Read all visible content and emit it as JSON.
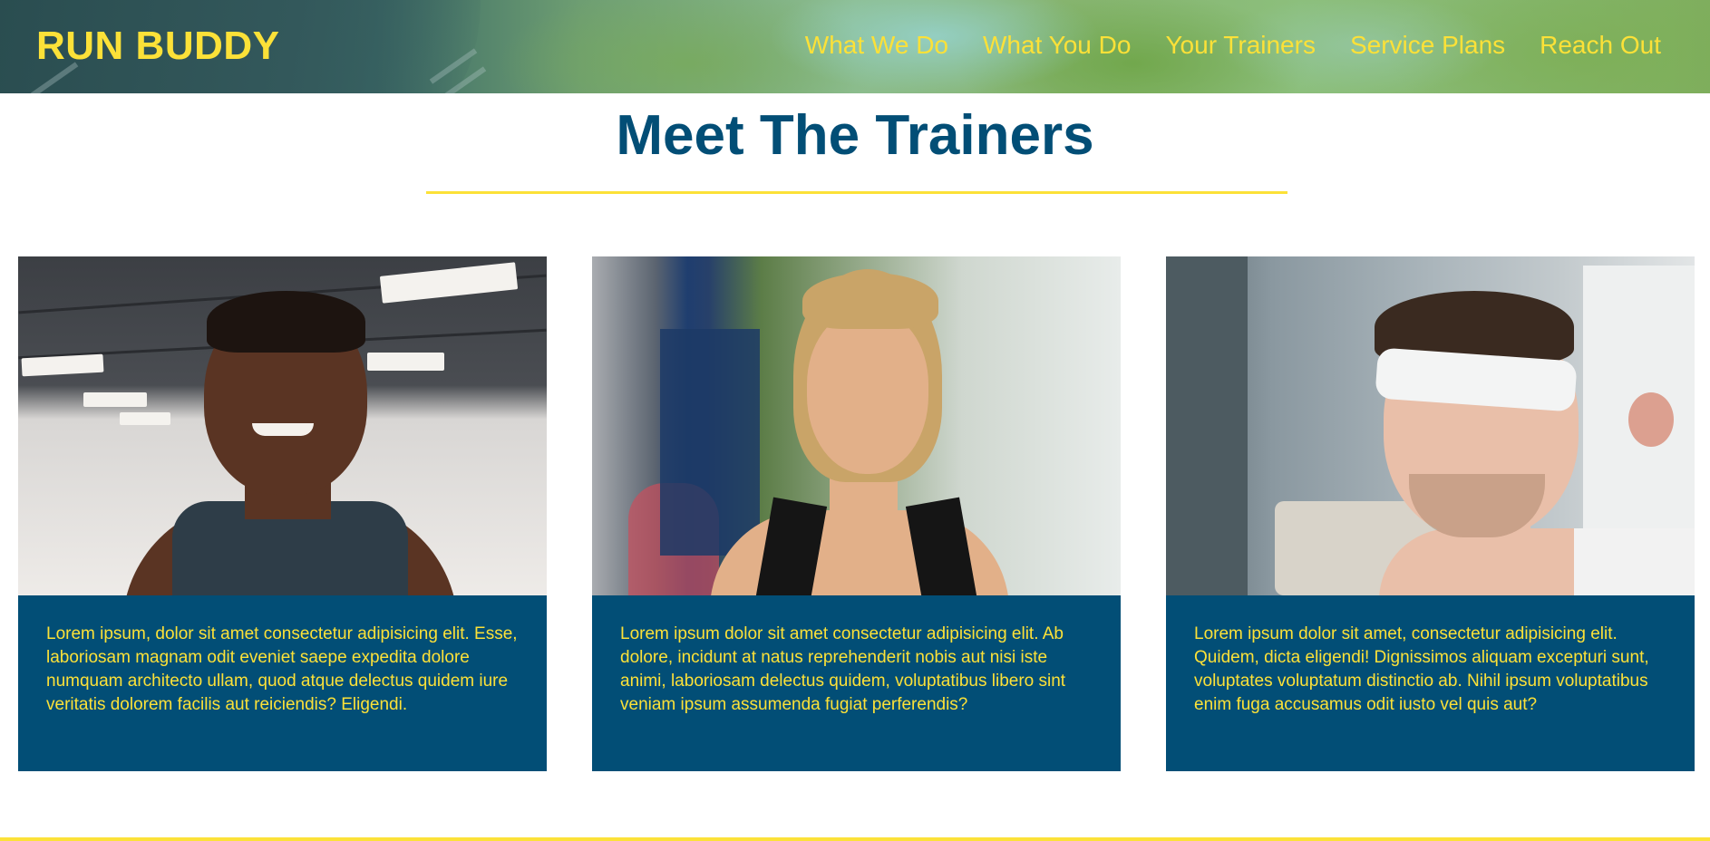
{
  "header": {
    "logo": "RUN BUDDY",
    "nav": [
      {
        "label": "What We Do"
      },
      {
        "label": "What You Do"
      },
      {
        "label": "Your Trainers"
      },
      {
        "label": "Service Plans"
      },
      {
        "label": "Reach Out"
      }
    ]
  },
  "section": {
    "title": "Meet The Trainers"
  },
  "trainers": [
    {
      "bio": "Lorem ipsum, dolor sit amet consectetur adipisicing elit. Esse, laboriosam magnam odit eveniet saepe expedita dolore numquam architecto ullam, quod atque delectus quidem iure veritatis dolorem facilis aut reiciendis? Eligendi."
    },
    {
      "bio": "Lorem ipsum dolor sit amet consectetur adipisicing elit. Ab dolore, incidunt at natus reprehenderit nobis aut nisi iste animi, laboriosam delectus quidem, voluptatibus libero sint veniam ipsum assumenda fugiat perferendis?"
    },
    {
      "bio": "Lorem ipsum dolor sit amet, consectetur adipisicing elit. Quidem, dicta eligendi! Dignissimos aliquam excepturi sunt, voluptates voluptatum distinctio ab. Nihil ipsum voluptatibus enim fuga accusamus odit iusto vel quis aut?"
    }
  ],
  "colors": {
    "primary": "#024e76",
    "accent": "#fce138",
    "background": "#ffffff"
  }
}
